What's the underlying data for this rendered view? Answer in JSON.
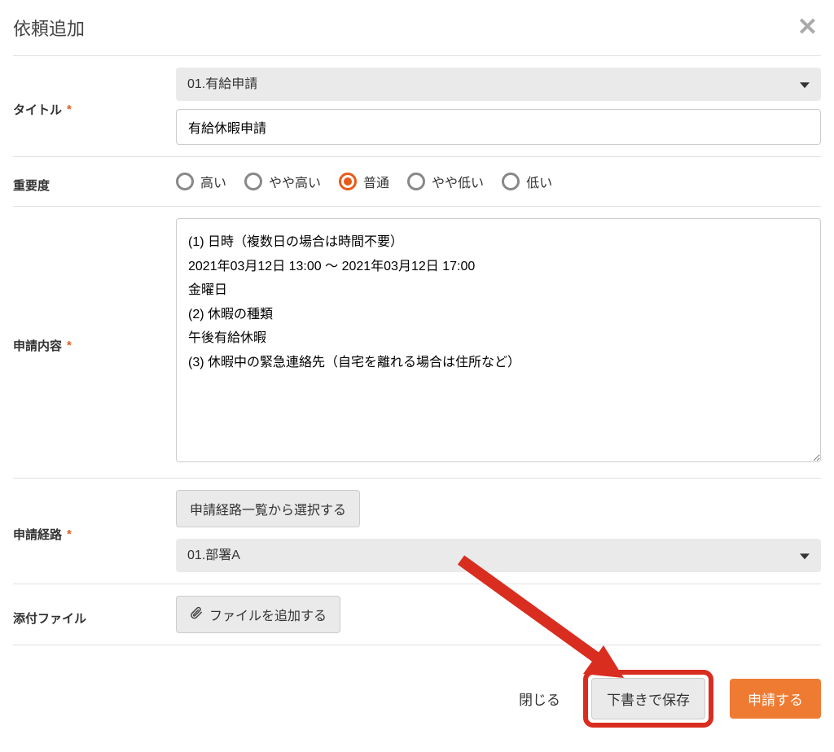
{
  "modal": {
    "title": "依頼追加"
  },
  "fields": {
    "title": {
      "label": "タイトル",
      "template_selected": "01.有給申請",
      "input_value": "有給休暇申請"
    },
    "importance": {
      "label": "重要度",
      "options": [
        "高い",
        "やや高い",
        "普通",
        "やや低い",
        "低い"
      ],
      "selected": "普通"
    },
    "content": {
      "label": "申請内容",
      "value": "(1) 日時（複数日の場合は時間不要）\n2021年03月12日 13:00 ～ 2021年03月12日 17:00\n金曜日\n(2) 休暇の種類\n午後有給休暇\n(3) 休暇中の緊急連絡先（自宅を離れる場合は住所など）\n"
    },
    "route": {
      "label": "申請経路",
      "select_from_list_label": "申請経路一覧から選択する",
      "selected": "01.部署A"
    },
    "attachment": {
      "label": "添付ファイル",
      "button_label": "ファイルを追加する"
    }
  },
  "footer": {
    "close_label": "閉じる",
    "draft_label": "下書きで保存",
    "submit_label": "申請する"
  }
}
